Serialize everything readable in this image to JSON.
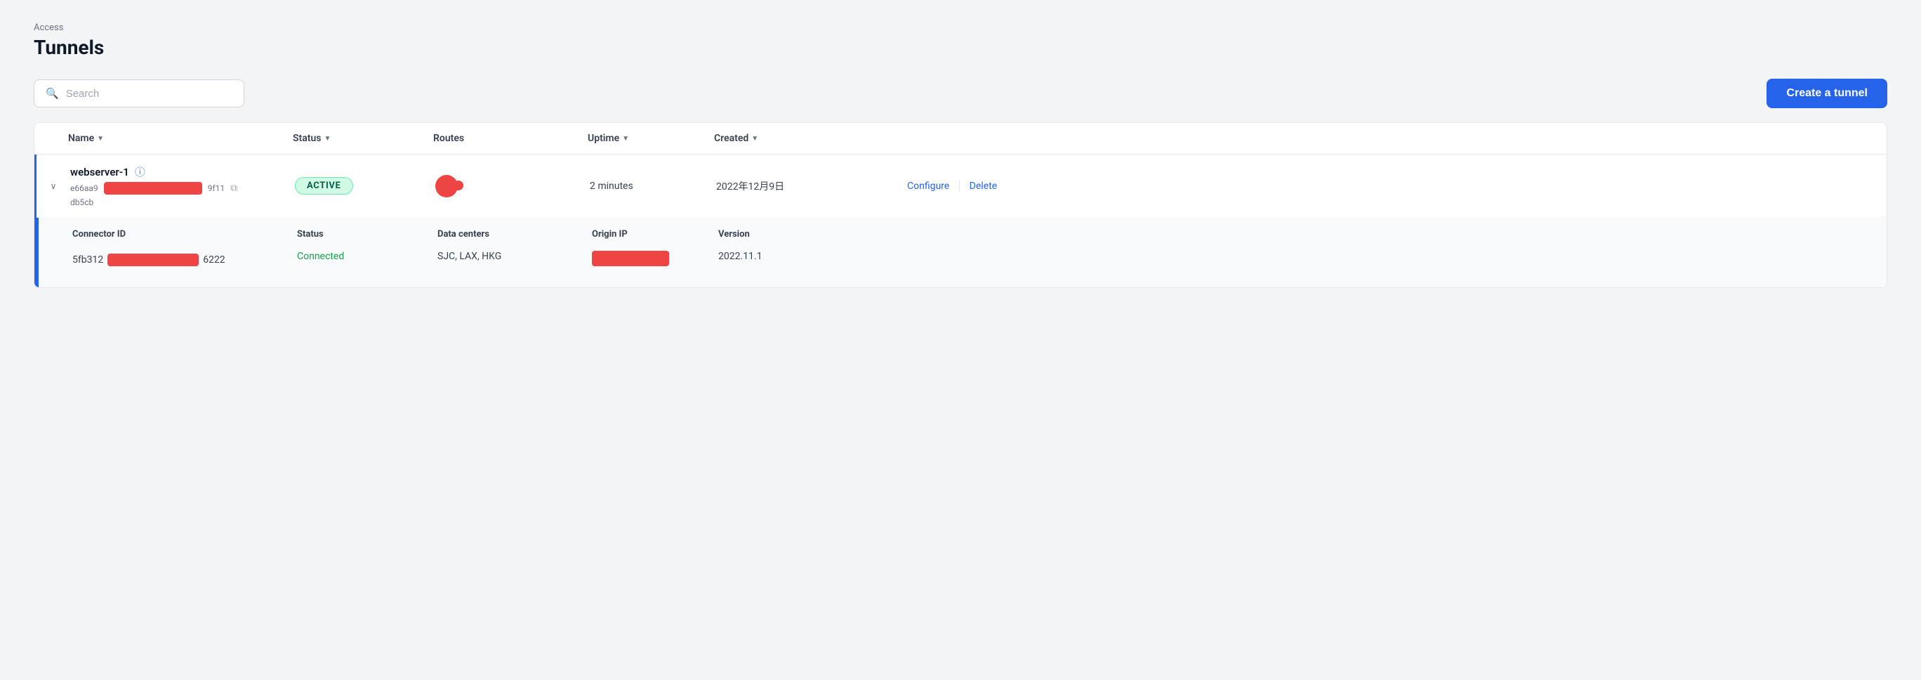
{
  "breadcrumb": "Access",
  "page_title": "Tunnels",
  "search": {
    "placeholder": "Search"
  },
  "create_button": "Create a tunnel",
  "table": {
    "columns": [
      {
        "key": "expand",
        "label": ""
      },
      {
        "key": "name",
        "label": "Name",
        "sortable": true
      },
      {
        "key": "status",
        "label": "Status",
        "sortable": true
      },
      {
        "key": "routes",
        "label": "Routes",
        "sortable": false
      },
      {
        "key": "uptime",
        "label": "Uptime",
        "sortable": true
      },
      {
        "key": "created",
        "label": "Created",
        "sortable": true
      },
      {
        "key": "actions",
        "label": ""
      }
    ],
    "tunnel": {
      "name": "webserver-1",
      "id_prefix": "e66aa9",
      "id_suffix": "9f11\ndb5cb",
      "status": "ACTIVE",
      "uptime": "2 minutes",
      "created": "2022年12月9日",
      "actions": {
        "configure": "Configure",
        "delete": "Delete"
      },
      "connector": {
        "id_prefix": "5fb312",
        "id_suffix": "6222",
        "status": "Connected",
        "data_centers": "SJC, LAX, HKG",
        "version": "2022.11.1",
        "headers": {
          "id": "Connector ID",
          "status": "Status",
          "data_centers": "Data centers",
          "origin_ip": "Origin IP",
          "version": "Version"
        }
      }
    }
  }
}
